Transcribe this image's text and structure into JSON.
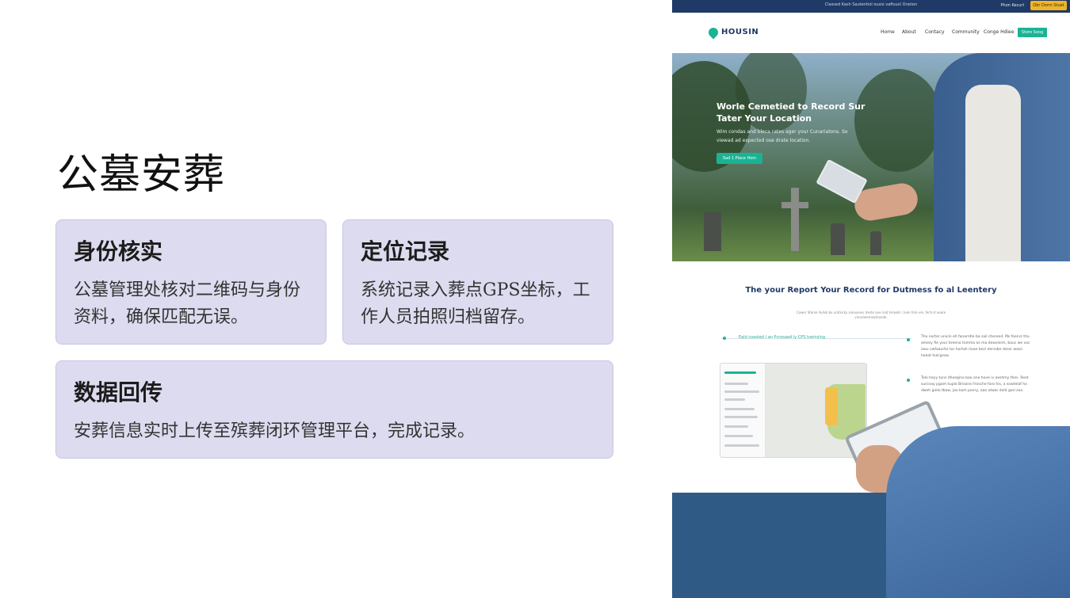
{
  "slide": {
    "title": "公墓安葬",
    "cards": [
      {
        "heading": "身份核实",
        "body": "公墓管理处核对二维码与身份资料，确保匹配无误。"
      },
      {
        "heading": "定位记录",
        "body": "系统记录入葬点GPS坐标，工作人员拍照归档留存。"
      },
      {
        "heading": "数据回传",
        "body": "安葬信息实时上传至殡葬闭环管理平台，完成记录。"
      }
    ]
  },
  "screenshot": {
    "topbar": {
      "notice": "Classed Kash Sautentiol ousio vaftsuxl Oration",
      "login": "Phon  Kecurl",
      "cta": "Obr Dorm Stuet"
    },
    "nav": {
      "logo": "HOUSIN",
      "items": [
        "Home",
        "About",
        "Contacy",
        "Community",
        "Conge Hdiee"
      ],
      "button": "Store Soog"
    },
    "hero": {
      "heading": "Worle Cemetied to Record Sur Tater Your Location",
      "subtext": "Wim condas and bleca rates ager your Cunariatons. So viewad ad expected ose drate location.",
      "button": "Sad 1 Place Hom"
    },
    "section": {
      "heading": "The your Report Your Record for Dutmess fo al Leentery",
      "subtext": "Cower Sforvk Avlisk be untrocky vianuesec deste ave inat terwolrr, Iven fore vie, ferts d aeare vinaraeemesslionde.",
      "feature": "Eald coasted I an Pcrosaed ly CPS toeinslng",
      "side1": "Tho norter unicin eh fanarrdle ba sail chereed. Ms foenrs tho amesy fie your breeno tomma os ma dewsierm, bauc we voc iaeu vwfaaurtis tor hortah rioae bocl derssbe dessr waso heoot hulcgrow.",
      "side2": "Tolo heyy tuns dhoegino bao one hove iv aeshmy thes. Reot surcnay pgam kuplo Brisonsi frosche faro his, a sowtelaf ho dweh gielo tbaw, jae kom ponry, aao otwar dold gssl oas."
    }
  }
}
